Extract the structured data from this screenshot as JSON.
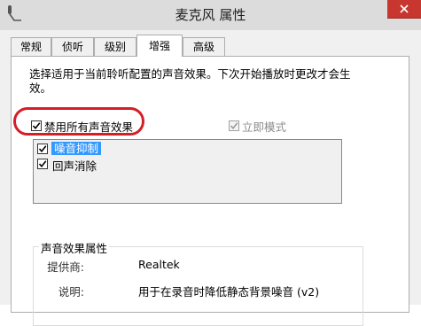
{
  "window": {
    "title": "麦克风 属性",
    "app_icon": "microphone-icon",
    "close_icon": "close-icon"
  },
  "tabs": [
    {
      "label": "常规"
    },
    {
      "label": "侦听"
    },
    {
      "label": "级别"
    },
    {
      "label": "增强",
      "active": true
    },
    {
      "label": "高级"
    }
  ],
  "panel": {
    "description": "选择适用于当前聆听配置的声音效果。下次开始播放时更改才会生效。",
    "disable_all": {
      "label": "禁用所有声音效果",
      "checked": true
    },
    "immediate_mode": {
      "label": "立即模式",
      "checked": true,
      "enabled": false
    },
    "effects": [
      {
        "label": "噪音抑制",
        "checked": true,
        "selected": true
      },
      {
        "label": "回声消除",
        "checked": true,
        "selected": false
      }
    ],
    "properties": {
      "group_title": "声音效果属性",
      "provider_label": "提供商:",
      "provider_value": "Realtek",
      "description_label": "说明:",
      "description_value": "用于在录音时降低静态背景噪音 (v2)"
    }
  },
  "colors": {
    "title_bar": "#dcdcdc",
    "close_button": "#c7372f",
    "selection": "#3399ff",
    "highlight_annotation": "#d41f27"
  }
}
